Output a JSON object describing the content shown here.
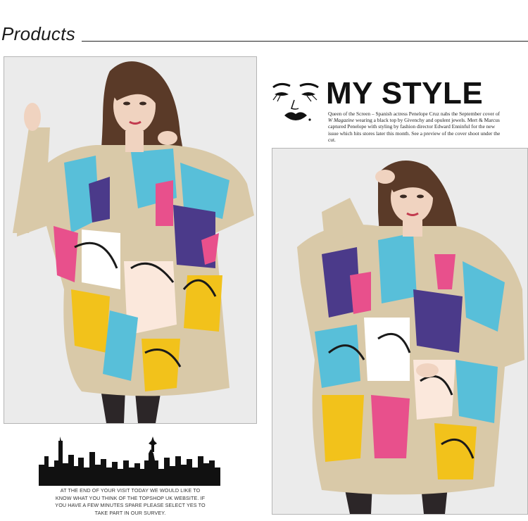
{
  "header": {
    "title": "Products"
  },
  "mystyle": {
    "title": "MY STYLE",
    "caption_parts": [
      "Queen of the Screen – Spanish actress Penelope Cruz nabs the September cover of ",
      "W Magazine",
      " wearing a black top by Givenchy and opulent jewels. Mert & Marcus captured Penelope with styling by fashion director Edward Enninful for the new issue which hits stores later this month. See a preview of the cover shoot under the cut."
    ]
  },
  "skyline": {
    "text": "AT THE END OF YOUR VISIT TODAY WE WOULD LIKE TO KNOW WHAT YOU THINK OF THE TOPSHOP UK WEBSITE. IF YOU HAVE A FEW MINUTES SPARE PLEASE SELECT YES TO TAKE PART IN OUR SURVEY."
  },
  "colors": {
    "background": "#ffffff",
    "photo_backdrop": "#ebebeb",
    "sweater_base": "#d9c9a8",
    "print_blue": "#58bfd9",
    "print_yellow": "#f2c21b",
    "print_pink": "#e8508c",
    "print_purple": "#4b3a8a",
    "hair": "#5a3a28",
    "skin": "#f0d3c0",
    "tights": "#2c2628"
  }
}
